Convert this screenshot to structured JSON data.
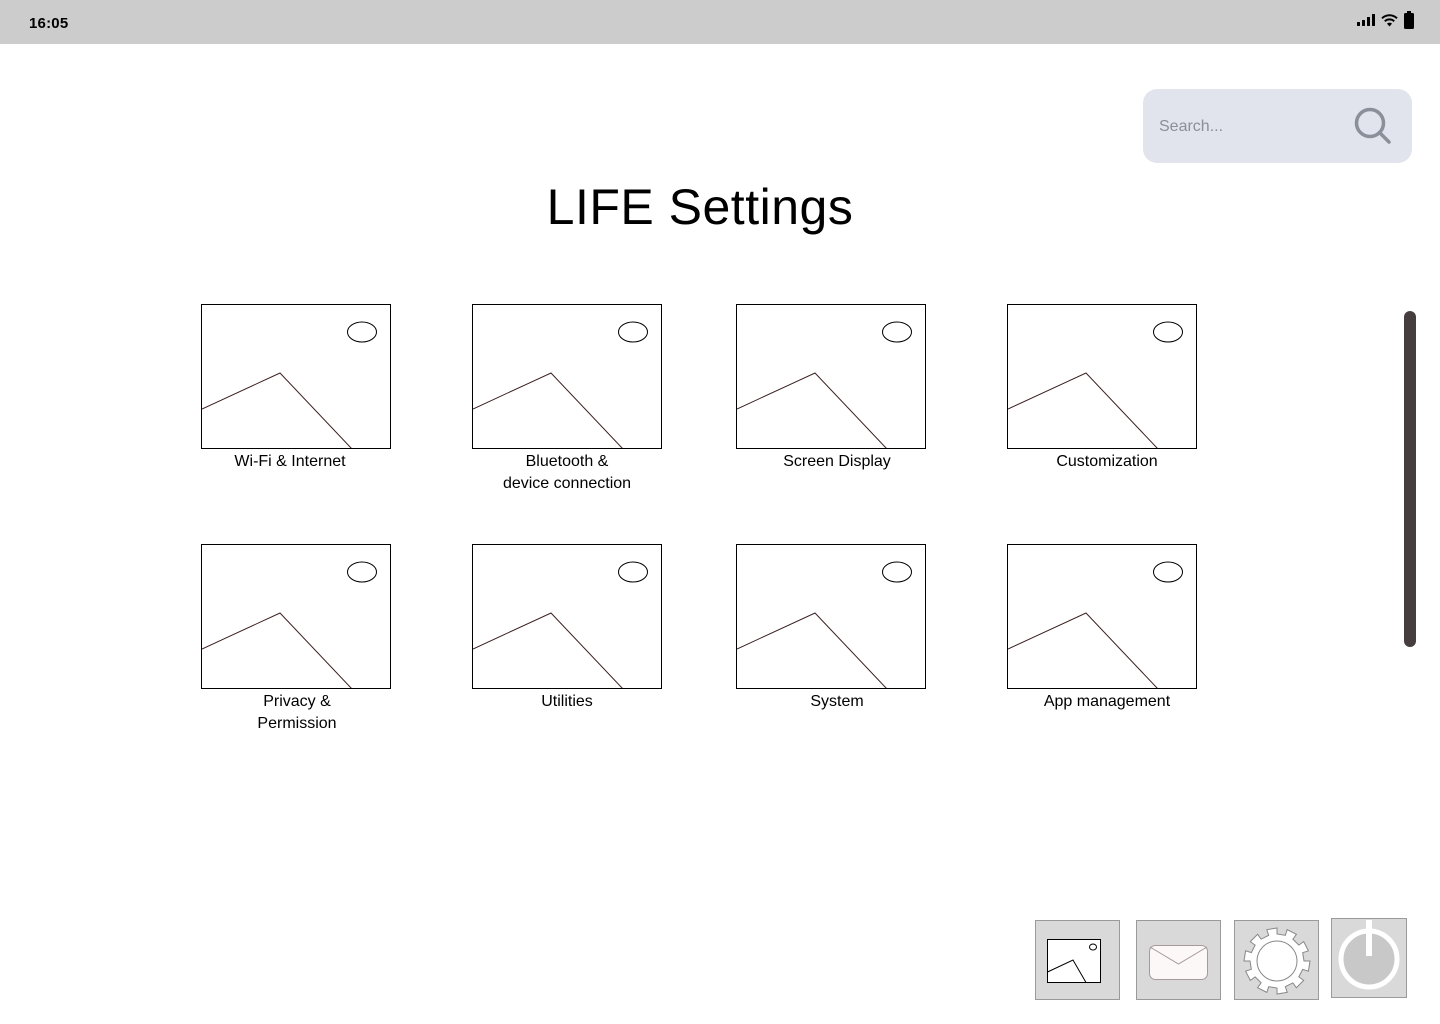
{
  "status_bar": {
    "time": "16:05",
    "icons": [
      "signal-icon",
      "wifi-icon",
      "battery-icon"
    ]
  },
  "search": {
    "placeholder": "Search...",
    "value": ""
  },
  "page": {
    "title": "LIFE Settings"
  },
  "tiles": [
    {
      "label": "Wi-Fi & Internet",
      "icon": "image-placeholder-icon"
    },
    {
      "label": "Bluetooth &\ndevice connection",
      "icon": "image-placeholder-icon"
    },
    {
      "label": "Screen Display",
      "icon": "image-placeholder-icon"
    },
    {
      "label": "Customization",
      "icon": "image-placeholder-icon"
    },
    {
      "label": "Privacy &\nPermission",
      "icon": "image-placeholder-icon"
    },
    {
      "label": "Utilities",
      "icon": "image-placeholder-icon"
    },
    {
      "label": "System",
      "icon": "image-placeholder-icon"
    },
    {
      "label": "App management",
      "icon": "image-placeholder-icon"
    }
  ],
  "dock": {
    "items": [
      "gallery-icon",
      "mail-icon",
      "settings-gear-icon",
      "power-icon"
    ]
  },
  "colors": {
    "status_bar_bg": "#cccccc",
    "search_bg": "#e1e4ec",
    "scrollbar": "#463e3e",
    "dock_bg": "#d9d9d9",
    "placeholder_text": "#8a8f9a"
  }
}
